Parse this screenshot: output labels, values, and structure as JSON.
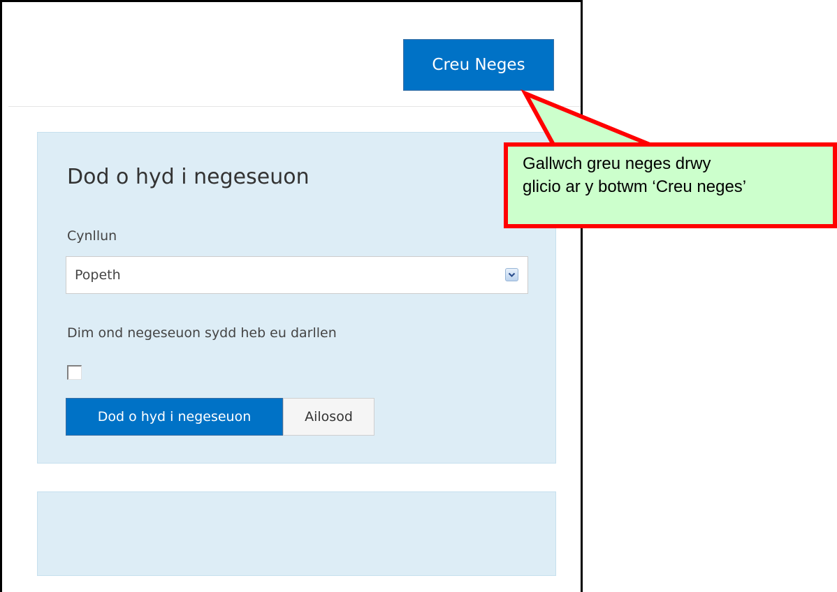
{
  "header": {
    "create_button_label": "Creu Neges"
  },
  "filter": {
    "title": "Dod o hyd i negeseuon",
    "plan_label": "Cynllun",
    "plan_selected": "Popeth",
    "unread_label": "Dim ond negeseuon sydd heb eu darllen",
    "unread_checked": false,
    "find_button_label": "Dod o hyd i negeseuon",
    "reset_button_label": "Ailosod"
  },
  "callout": {
    "line1": "Gallwch greu neges drwy",
    "line2": "glicio ar y botwm ‘Creu neges’",
    "fill_color": "#ccffcc",
    "border_color": "#ff0000"
  },
  "colors": {
    "primary_button": "#0072c6",
    "panel_background": "#ddedf6"
  }
}
